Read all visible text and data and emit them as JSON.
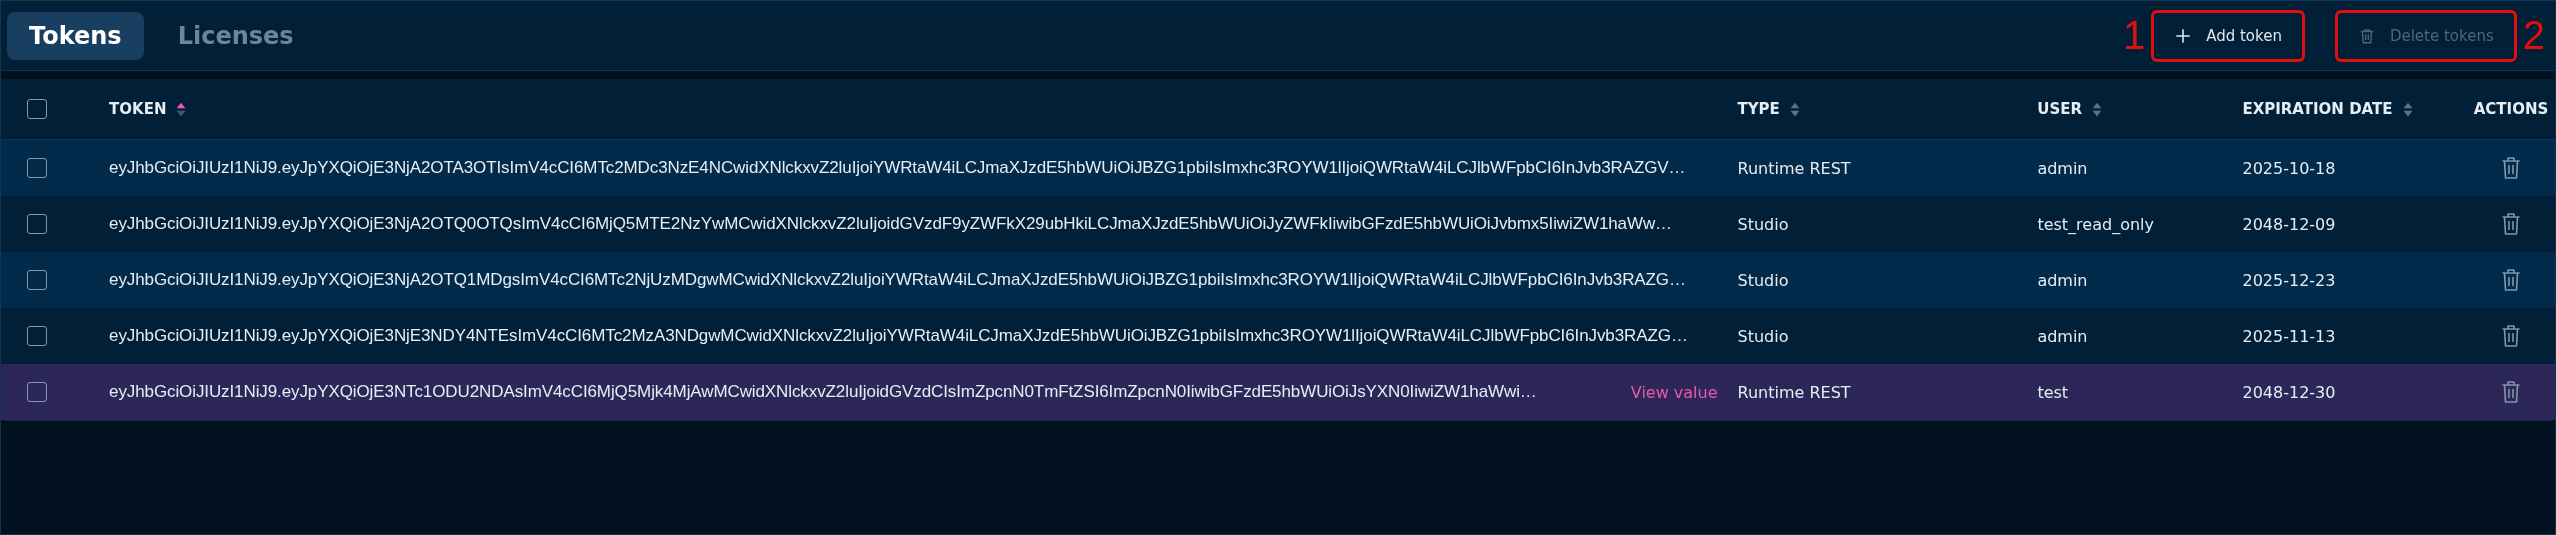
{
  "tabs": [
    {
      "label": "Tokens",
      "selected": true
    },
    {
      "label": "Licenses",
      "selected": false
    }
  ],
  "toolbar": {
    "items": [
      {
        "kind": "marker",
        "label": "1"
      },
      {
        "kind": "add",
        "label": "Add token",
        "disabled": false,
        "annotated": true
      },
      {
        "kind": "delete",
        "label": "Delete tokens",
        "disabled": true,
        "annotated": true
      },
      {
        "kind": "marker",
        "label": "2"
      }
    ]
  },
  "table": {
    "columns": [
      {
        "label": "TOKEN",
        "sorted": true
      },
      {
        "label": "TYPE",
        "sorted": false
      },
      {
        "label": "USER",
        "sorted": false
      },
      {
        "label": "EXPIRATION DATE",
        "sorted": false
      },
      {
        "label": "ACTIONS"
      }
    ],
    "select_all_checked": false,
    "rows": [
      {
        "token": "eyJhbGciOiJIUzI1NiJ9.eyJpYXQiOjE3NjA2OTA3OTIsImV4cCI6MTc2MDc3NzE4NCwidXNlckxvZ2luIjoiYWRtaW4iLCJmaXJzdE5hbWUiOiJBZG1pbiIsImxhc3ROYW1lIjoiQWRtaW4iLCJlbWFpbCI6InJvb3RAZGV…",
        "type": "Runtime REST",
        "user": "admin",
        "expiration": "2025-10-18",
        "checked": false,
        "hovered": false
      },
      {
        "token": "eyJhbGciOiJIUzI1NiJ9.eyJpYXQiOjE3NjA2OTQ0OTQsImV4cCI6MjQ5MTE2NzYwMCwidXNlckxvZ2luIjoidGVzdF9yZWFkX29ubHkiLCJmaXJzdE5hbWUiOiJyZWFkIiwibGFzdE5hbWUiOiJvbmx5IiwiZW1haWw…",
        "type": "Studio",
        "user": "test_read_only",
        "expiration": "2048-12-09",
        "checked": false,
        "hovered": false
      },
      {
        "token": "eyJhbGciOiJIUzI1NiJ9.eyJpYXQiOjE3NjA2OTQ1MDgsImV4cCI6MTc2NjUzMDgwMCwidXNlckxvZ2luIjoiYWRtaW4iLCJmaXJzdE5hbWUiOiJBZG1pbiIsImxhc3ROYW1lIjoiQWRtaW4iLCJlbWFpbCI6InJvb3RAZG…",
        "type": "Studio",
        "user": "admin",
        "expiration": "2025-12-23",
        "checked": false,
        "hovered": false
      },
      {
        "token": "eyJhbGciOiJIUzI1NiJ9.eyJpYXQiOjE3NjE3NDY4NTEsImV4cCI6MTc2MzA3NDgwMCwidXNlckxvZ2luIjoiYWRtaW4iLCJmaXJzdE5hbWUiOiJBZG1pbiIsImxhc3ROYW1lIjoiQWRtaW4iLCJlbWFpbCI6InJvb3RAZG…",
        "type": "Studio",
        "user": "admin",
        "expiration": "2025-11-13",
        "checked": false,
        "hovered": false
      },
      {
        "token": "eyJhbGciOiJIUzI1NiJ9.eyJpYXQiOjE3NTc1ODU2NDAsImV4cCI6MjQ5Mjk4MjAwMCwidXNlckxvZ2luIjoidGVzdCIsImZpcnN0TmFtZSI6ImZpcnN0IiwibGFzdE5hbWUiOiJsYXN0IiwiZW1haWwi…",
        "type": "Runtime REST",
        "user": "test",
        "expiration": "2048-12-30",
        "checked": false,
        "hovered": true,
        "hover_action": "View value"
      }
    ]
  }
}
